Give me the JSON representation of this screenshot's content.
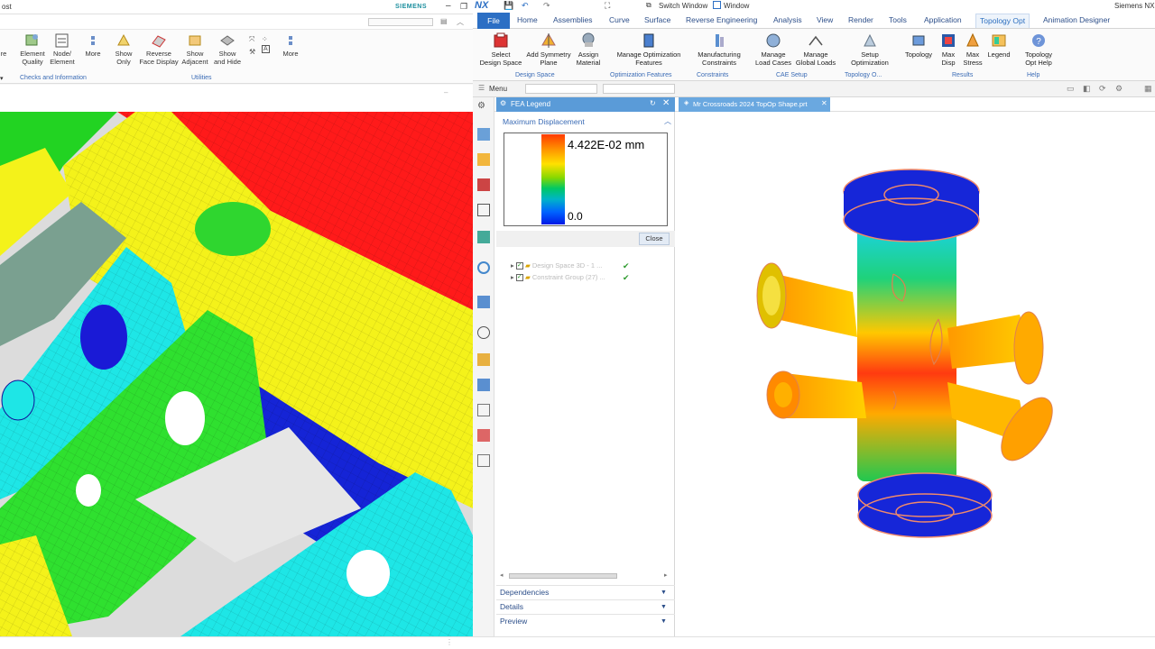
{
  "left_window": {
    "title_fragment": "ost",
    "brand": "SIEMENS",
    "ribbon_buttons": [
      {
        "label": "re",
        "icon": "partial-icon"
      },
      {
        "label": "Element\nQuality",
        "icon": "element-quality-icon"
      },
      {
        "label": "Node/\nElement",
        "icon": "node-element-icon"
      },
      {
        "label": "More",
        "icon": "more-icon"
      },
      {
        "label": "Show\nOnly",
        "icon": "show-only-icon"
      },
      {
        "label": "Reverse\nFace Display",
        "icon": "reverse-face-icon"
      },
      {
        "label": "Show\nAdjacent",
        "icon": "show-adjacent-icon"
      },
      {
        "label": "Show\nand Hide",
        "icon": "show-hide-icon"
      },
      {
        "label": "More",
        "icon": "more-icon"
      }
    ],
    "group_labels": [
      "Checks and Information",
      "Utilities"
    ]
  },
  "right_window": {
    "logo": "NX",
    "switch_window": "Switch Window",
    "window_menu": "Window",
    "app_name": "Siemens NX",
    "tabs": [
      "File",
      "Home",
      "Assemblies",
      "Curve",
      "Surface",
      "Reverse Engineering",
      "Analysis",
      "View",
      "Render",
      "Tools",
      "Application",
      "Topology Opt",
      "Animation Designer"
    ],
    "active_tab": "Topology Opt",
    "ribbon_buttons": [
      {
        "label": "Select\nDesign Space",
        "icon": "design-space-icon"
      },
      {
        "label": "Add Symmetry\nPlane",
        "icon": "symmetry-plane-icon"
      },
      {
        "label": "Assign\nMaterial",
        "icon": "material-icon"
      },
      {
        "label": "Manage Optimization\nFeatures",
        "icon": "optimization-features-icon"
      },
      {
        "label": "Manufacturing\nConstraints",
        "icon": "manufacturing-constraints-icon"
      },
      {
        "label": "Manage\nLoad Cases",
        "icon": "load-cases-icon"
      },
      {
        "label": "Manage\nGlobal Loads",
        "icon": "global-loads-icon"
      },
      {
        "label": "Setup\nOptimization",
        "icon": "setup-optimization-icon"
      },
      {
        "label": "Topology",
        "icon": "topology-icon"
      },
      {
        "label": "Max\nDisp",
        "icon": "max-disp-icon"
      },
      {
        "label": "Max\nStress",
        "icon": "max-stress-icon"
      },
      {
        "label": "Legend",
        "icon": "legend-icon"
      },
      {
        "label": "Topology\nOpt Help",
        "icon": "help-icon"
      }
    ],
    "group_labels": [
      "Design Space",
      "Optimization Features",
      "Constraints",
      "CAE Setup",
      "Topology O...",
      "Results",
      "Help"
    ],
    "menu_label": "Menu",
    "panel_title": "FEA Legend",
    "doc_tab": "Mr Crossroads 2024 TopOp Shape.prt",
    "legend": {
      "section_label": "Maximum Displacement",
      "max_value": "4.422E-02 mm",
      "min_value": "0.0",
      "close_button": "Close"
    },
    "tree_items": [
      {
        "label": "Design Space 3D - 1 ...",
        "checked": true
      },
      {
        "label": "Constraint Group (27) ...",
        "checked": true
      }
    ],
    "bottom_sections": [
      "Dependencies",
      "Details",
      "Preview"
    ]
  },
  "colors": {
    "accent_blue": "#2c6fc4",
    "panel_header": "#5a9bd8",
    "check_green": "#2e9b2e"
  }
}
